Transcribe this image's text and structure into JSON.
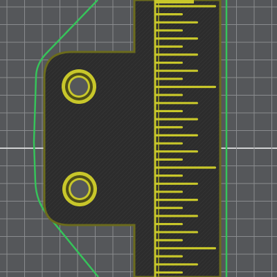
{
  "viewport": {
    "view": "slicer-layer-preview",
    "colors": {
      "bed": "#55575a",
      "grid_line": "#8a8c8f",
      "grid_line_major": "#d2d3d4",
      "skirt": "#36c45a",
      "wall_outer": "#c8c72a",
      "wall_dark": "#545416",
      "infill": "#2c2c2c",
      "infill_hatch": "#363636"
    },
    "icons": {
      "tick": "ruler-tick-icon",
      "hole": "screw-hole-icon"
    },
    "part": {
      "holes": 2,
      "ruler_ticks": 35
    }
  }
}
